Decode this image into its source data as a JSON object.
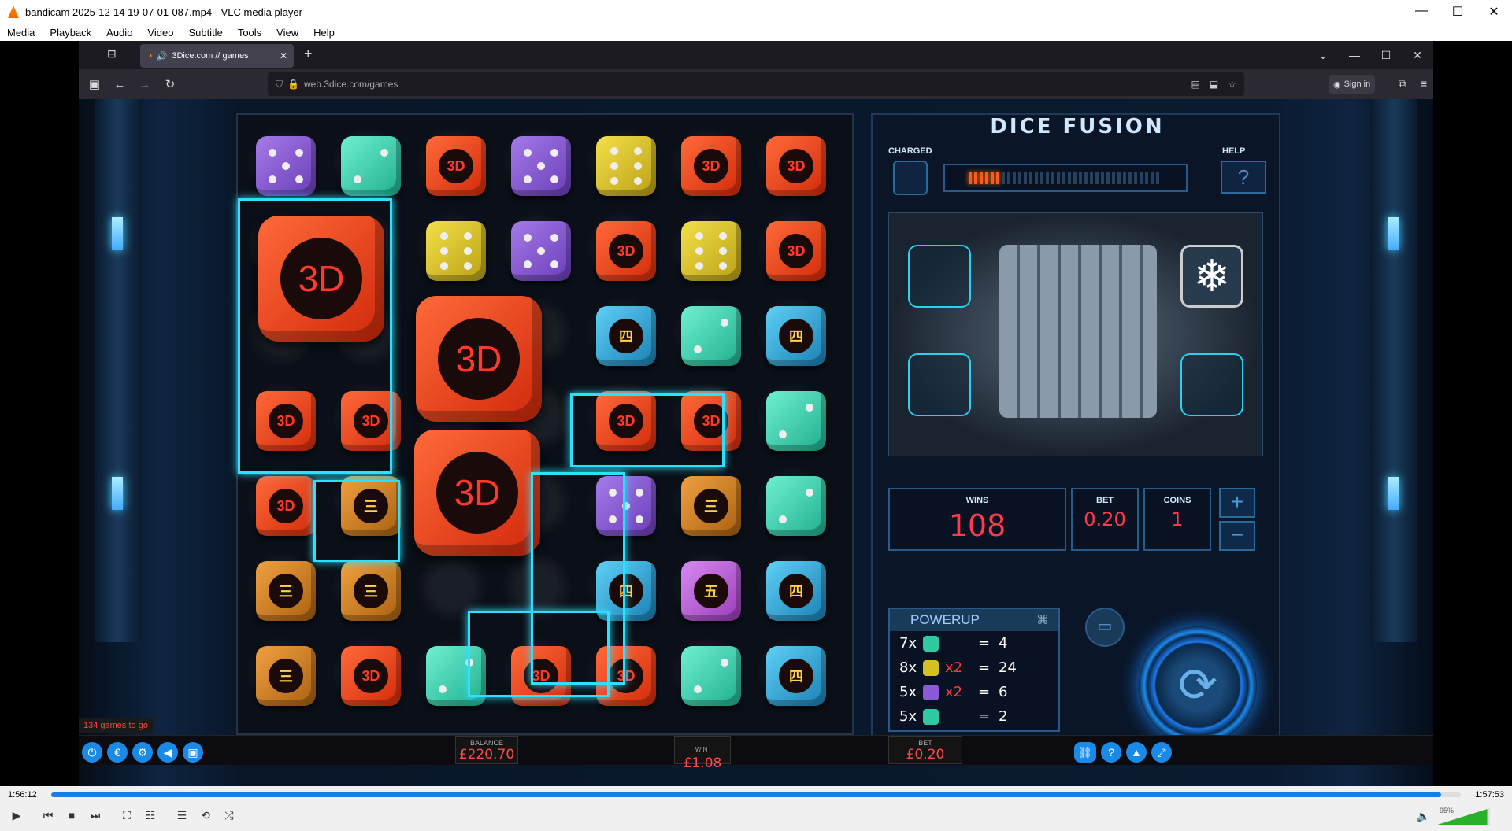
{
  "vlc": {
    "title": "bandicam 2025-12-14 19-07-01-087.mp4 - VLC media player",
    "menu": [
      "Media",
      "Playback",
      "Audio",
      "Video",
      "Subtitle",
      "Tools",
      "View",
      "Help"
    ],
    "time_current": "1:56:12",
    "time_total": "1:57:53",
    "progress": 0.986,
    "volume": "95%"
  },
  "browser": {
    "tab_title": "3Dice.com // games",
    "url": "web.3dice.com/games",
    "signin": "Sign in"
  },
  "game": {
    "title": "DICE FUSION",
    "charged_label": "CHARGED",
    "help_label": "HELP",
    "help_symbol": "?",
    "charge_level": 0.17,
    "wins_label": "WINS",
    "wins": "108",
    "bet_label": "BET",
    "bet": "0.20",
    "coins_label": "COINS",
    "coins": "1",
    "plus": "+",
    "minus": "−",
    "powerup_title": "POWERUP",
    "powerup_rows": [
      {
        "qty": "7x",
        "color": "#2fc9a0",
        "mult": "",
        "eq": "=",
        "val": "4"
      },
      {
        "qty": "8x",
        "color": "#d4c020",
        "mult": "x2",
        "eq": "=",
        "val": "24"
      },
      {
        "qty": "5x",
        "color": "#8a5ad8",
        "mult": "x2",
        "eq": "=",
        "val": "6"
      },
      {
        "qty": "5x",
        "color": "#2fc9a0",
        "mult": "",
        "eq": "=",
        "val": "2"
      }
    ],
    "games_left": "134 games to go",
    "balance_label": "BALANCE",
    "balance": "£220.70",
    "win_label": "WIN",
    "win": "£1.08",
    "bottom_bet_label": "BET",
    "bottom_bet": "£0.20",
    "die_label": "3D",
    "cjk_three": "三",
    "cjk_four": "四",
    "cjk_five": "五"
  }
}
